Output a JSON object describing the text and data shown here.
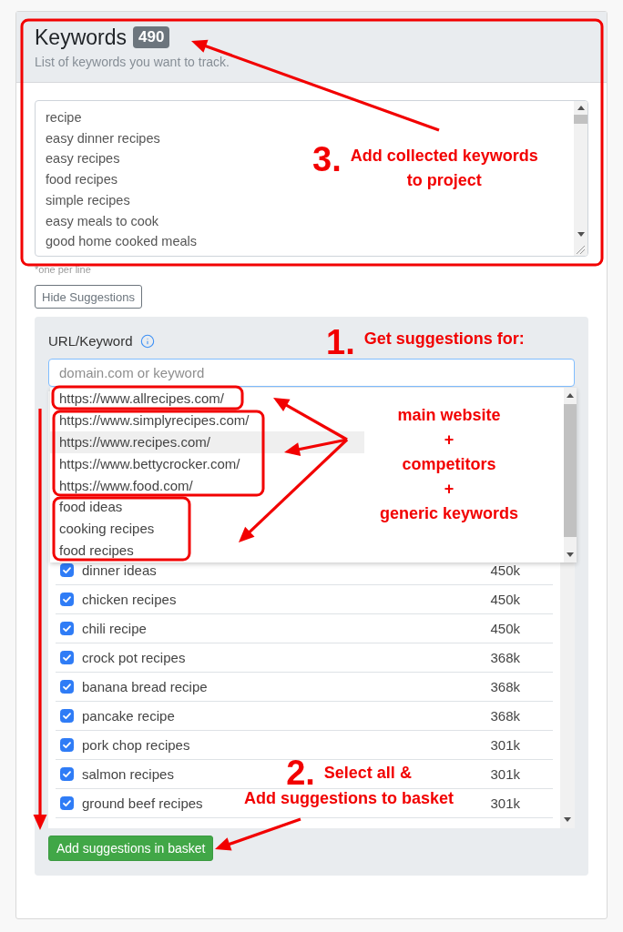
{
  "keywords_card": {
    "title": "Keywords",
    "count": "490",
    "subtitle": "List of keywords you want to track.",
    "keywords": [
      "recipe",
      "easy dinner recipes",
      "easy recipes",
      "food recipes",
      "simple recipes",
      "easy meals to cook",
      "good home cooked meals"
    ],
    "hint": "*one per line"
  },
  "toggle_button": {
    "label": "Hide Suggestions"
  },
  "suggestions_panel": {
    "field_label": "URL/Keyword",
    "input": {
      "placeholder": "domain.com or keyword"
    },
    "dropdown": [
      {
        "text": "https://www.allrecipes.com/",
        "selected": false
      },
      {
        "text": "https://www.simplyrecipes.com/",
        "selected": false
      },
      {
        "text": "https://www.recipes.com/",
        "selected": true
      },
      {
        "text": "https://www.bettycrocker.com/",
        "selected": false
      },
      {
        "text": "https://www.food.com/",
        "selected": false
      },
      {
        "text": "food ideas",
        "selected": false
      },
      {
        "text": "cooking recipes",
        "selected": false
      },
      {
        "text": "food recipes",
        "selected": false
      }
    ],
    "results": [
      {
        "keyword": "dinner ideas",
        "volume": "450k",
        "checked": true
      },
      {
        "keyword": "chicken recipes",
        "volume": "450k",
        "checked": true
      },
      {
        "keyword": "chili recipe",
        "volume": "450k",
        "checked": true
      },
      {
        "keyword": "crock pot recipes",
        "volume": "368k",
        "checked": true
      },
      {
        "keyword": "banana bread recipe",
        "volume": "368k",
        "checked": true
      },
      {
        "keyword": "pancake recipe",
        "volume": "368k",
        "checked": true
      },
      {
        "keyword": "pork chop recipes",
        "volume": "301k",
        "checked": true
      },
      {
        "keyword": "salmon recipes",
        "volume": "301k",
        "checked": true
      },
      {
        "keyword": "ground beef recipes",
        "volume": "301k",
        "checked": true
      }
    ],
    "add_button": {
      "label": "Add suggestions in basket"
    }
  },
  "annotations": [
    {
      "kind": "step",
      "number": "3.",
      "lines": [
        "Add collected keywords",
        "to project"
      ]
    },
    {
      "kind": "step",
      "number": "1.",
      "lines": [
        "Get suggestions for:"
      ]
    },
    {
      "kind": "note",
      "lines": [
        "main website",
        "+",
        "competitors",
        "+",
        "generic keywords"
      ]
    },
    {
      "kind": "step",
      "number": "2.",
      "lines": [
        "Select all &",
        "Add suggestions to basket"
      ]
    }
  ]
}
